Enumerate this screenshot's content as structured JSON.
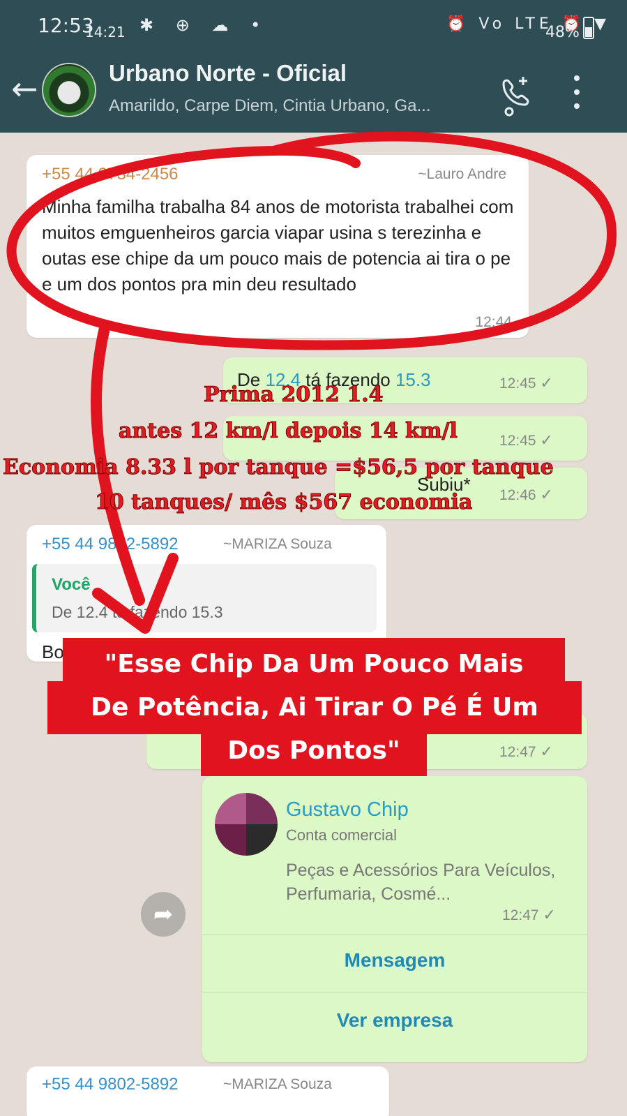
{
  "status_bar": {
    "time": "12:53",
    "time_overlay": "14:21",
    "left_icons": "✱ ⊕ ☁ •",
    "right_icons": "⏰ Vo LTE ⏰ ▼",
    "battery": "48%"
  },
  "header": {
    "title": "Urbano Norte - Oficial",
    "subtitle": "Amarildo, Carpe Diem, Cintia Urbano, Ga..."
  },
  "messages": {
    "m1": {
      "sender": "+55 44 9734-2456",
      "sender_name": "~Lauro Andre",
      "text": "Minha familha trabalha 84 anos de motorista trabalhei com muitos emguenheiros garcia viapar usina s terezinha e outas ese chipe da um pouco mais de potencia ai tira o pe e um dos pontos pra min deu resultado",
      "time": "12:44"
    },
    "m2": {
      "text_prefix": "De ",
      "value_from": "12.4",
      "text_mid": " tá fazendo ",
      "value_to": "15.3",
      "time": "12:45"
    },
    "m3": {
      "time": "12:45"
    },
    "m4": {
      "text": "Subiu*",
      "time": "12:46"
    },
    "m5": {
      "sender": "+55 44 9802-5892",
      "sender_name": "~MARIZA Souza",
      "quote_author": "Você",
      "quote_text": "De 12.4 tá fazendo 15.3",
      "text": "Bo"
    },
    "m6": {
      "time": "12:47"
    },
    "m7": {
      "card_name": "Gustavo Chip",
      "card_type": "Conta comercial",
      "card_desc": "Peças e Acessórios Para Veículos, Perfumaria,  Cosmé...",
      "time": "12:47",
      "button_message": "Mensagem",
      "button_business": "Ver empresa"
    },
    "m8": {
      "sender": "+55 44 9802-5892",
      "sender_name": "~MARIZA Souza"
    },
    "check": "✓"
  },
  "overlay": {
    "line1": "Prima 2012 1.4",
    "line2": "antes 12 km/l depois 14 km/l",
    "line3": "Economia  8.33 l por tanque =$56,5 por tanque",
    "line4": "10 tanques/ mês $567 economia",
    "callout1": "\"Esse Chip Da Um Pouco Mais",
    "callout2": "De Potência, Ai Tirar O Pé É Um",
    "callout3": "Dos Pontos\""
  },
  "icons": {
    "back": "back-arrow-icon",
    "call": "add-call-icon",
    "menu": "more-vert-icon",
    "forward": "forward-icon"
  },
  "colors": {
    "header": "#2f4d55",
    "chat_bg": "#e5ddd5",
    "outgoing": "#dcf8c6",
    "annotation_red": "#e0131e"
  }
}
